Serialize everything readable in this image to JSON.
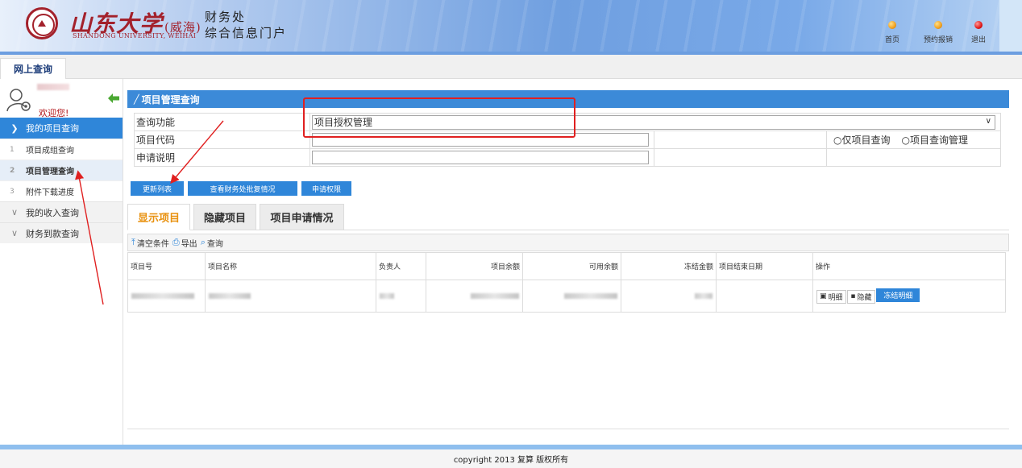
{
  "header": {
    "school_name": "山东大学",
    "school_campus": "(威海)",
    "school_english": "SHANDONG UNIVERSITY, WEIHAI",
    "portal_line1": "财务处",
    "portal_line2": "综合信息门户",
    "nav": [
      {
        "label": "首页",
        "dot_color": "#f0a020"
      },
      {
        "label": "预约报销",
        "dot_color": "#f0a020"
      },
      {
        "label": "退出",
        "dot_color": "#e01818"
      }
    ]
  },
  "tabstrip": {
    "online_query": "网上查询"
  },
  "sidebar": {
    "welcome": "欢迎您!",
    "groups": [
      {
        "label": "我的项目查询",
        "expanded": true,
        "items": [
          {
            "num": "1",
            "label": "项目成组查询"
          },
          {
            "num": "2",
            "label": "项目管理查询",
            "selected": true
          },
          {
            "num": "3",
            "label": "附件下载进度"
          }
        ]
      },
      {
        "label": "我的收入查询",
        "expanded": false
      },
      {
        "label": "财务到款查询",
        "expanded": false
      }
    ]
  },
  "main": {
    "section_title": "项目管理查询",
    "form": {
      "query_function_label": "查询功能",
      "query_function_value": "项目授权管理",
      "project_code_label": "项目代码",
      "project_code_value": "",
      "description_label": "申请说明",
      "description_value": "",
      "radio_options": [
        "仅项目查询",
        "项目查询管理"
      ]
    },
    "buttons": {
      "refresh_list": "更新列表",
      "view_approval": "查看财务处批复情况",
      "apply_permission": "申请权限"
    },
    "tabs": [
      "显示项目",
      "隐藏项目",
      "项目申请情况"
    ],
    "toolbar": {
      "clear": "清空条件",
      "export": "导出",
      "query": "查询"
    },
    "table": {
      "columns": [
        "项目号",
        "项目名称",
        "负责人",
        "项目余额",
        "可用余额",
        "冻结金额",
        "项目结束日期",
        "操作"
      ],
      "row_actions": {
        "detail": "明细",
        "hide": "隐藏",
        "frozen_detail": "冻结明细"
      }
    }
  },
  "footer": {
    "copyright": "copyright 2013 复算 版权所有"
  },
  "colors": {
    "accent": "#2f86d9",
    "brand": "#a3212b",
    "annotation": "#e02020",
    "active_tab": "#e8910f"
  }
}
